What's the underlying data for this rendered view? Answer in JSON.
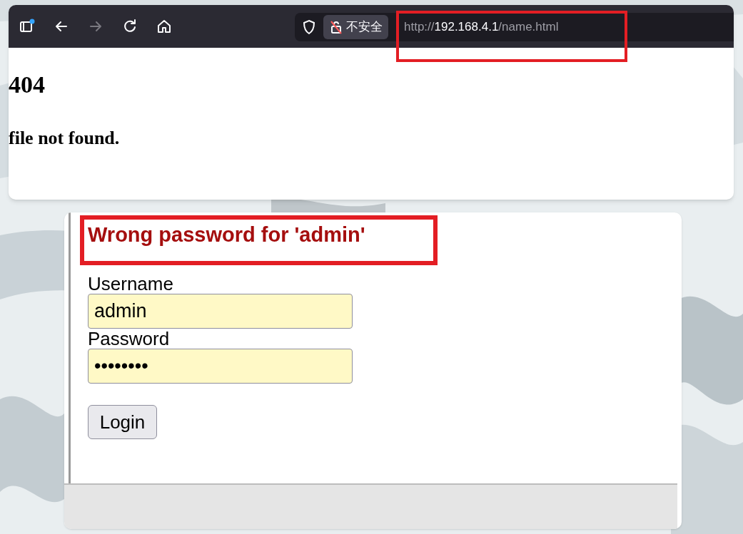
{
  "browser": {
    "buttons": [
      {
        "kind": "sidebar",
        "disabled": false
      },
      {
        "kind": "back",
        "disabled": false
      },
      {
        "kind": "forward",
        "disabled": true
      },
      {
        "kind": "reload",
        "disabled": false
      },
      {
        "kind": "home",
        "disabled": false
      }
    ],
    "security": {
      "label": "不安全"
    },
    "url": {
      "scheme": "http://",
      "host": "192.168.4.1",
      "path": "/name.html",
      "highlighted": true
    }
  },
  "page": {
    "heading": "404",
    "message": "file not found."
  },
  "login": {
    "error": "Wrong password for 'admin'",
    "highlighted": true,
    "fields": [
      {
        "label": "Username",
        "value": "admin"
      },
      {
        "label": "Password",
        "value": "••••••••"
      }
    ],
    "button": "Login"
  }
}
